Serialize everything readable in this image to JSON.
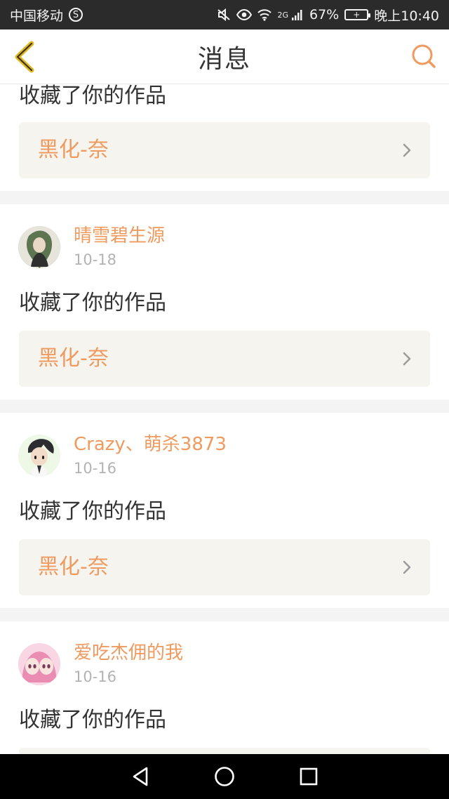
{
  "status_bar": {
    "carrier": "中国移动",
    "carrier_badge": "S",
    "network": "2G",
    "battery_percent": "67%",
    "time": "晚上10:40"
  },
  "header": {
    "title": "消息",
    "back_icon": "chevron-left-icon",
    "search_icon": "search-icon"
  },
  "messages": [
    {
      "action": "收藏了你的作品",
      "work_title": "黑化-奈"
    },
    {
      "user": "晴雪碧生源",
      "date": "10-18",
      "action": "收藏了你的作品",
      "work_title": "黑化-奈"
    },
    {
      "user": "Crazy、萌杀3873",
      "date": "10-16",
      "action": "收藏了你的作品",
      "work_title": "黑化-奈"
    },
    {
      "user": "爱吃杰佣的我",
      "date": "10-16",
      "action": "收藏了你的作品"
    }
  ],
  "colors": {
    "accent": "#ef9a5f",
    "text": "#333333",
    "muted": "#b3b3b3",
    "surface": "#f5f4ef",
    "status_bar": "#2b2b2b"
  },
  "nav": {
    "back": "back-icon",
    "home": "home-icon",
    "recents": "recents-icon"
  }
}
